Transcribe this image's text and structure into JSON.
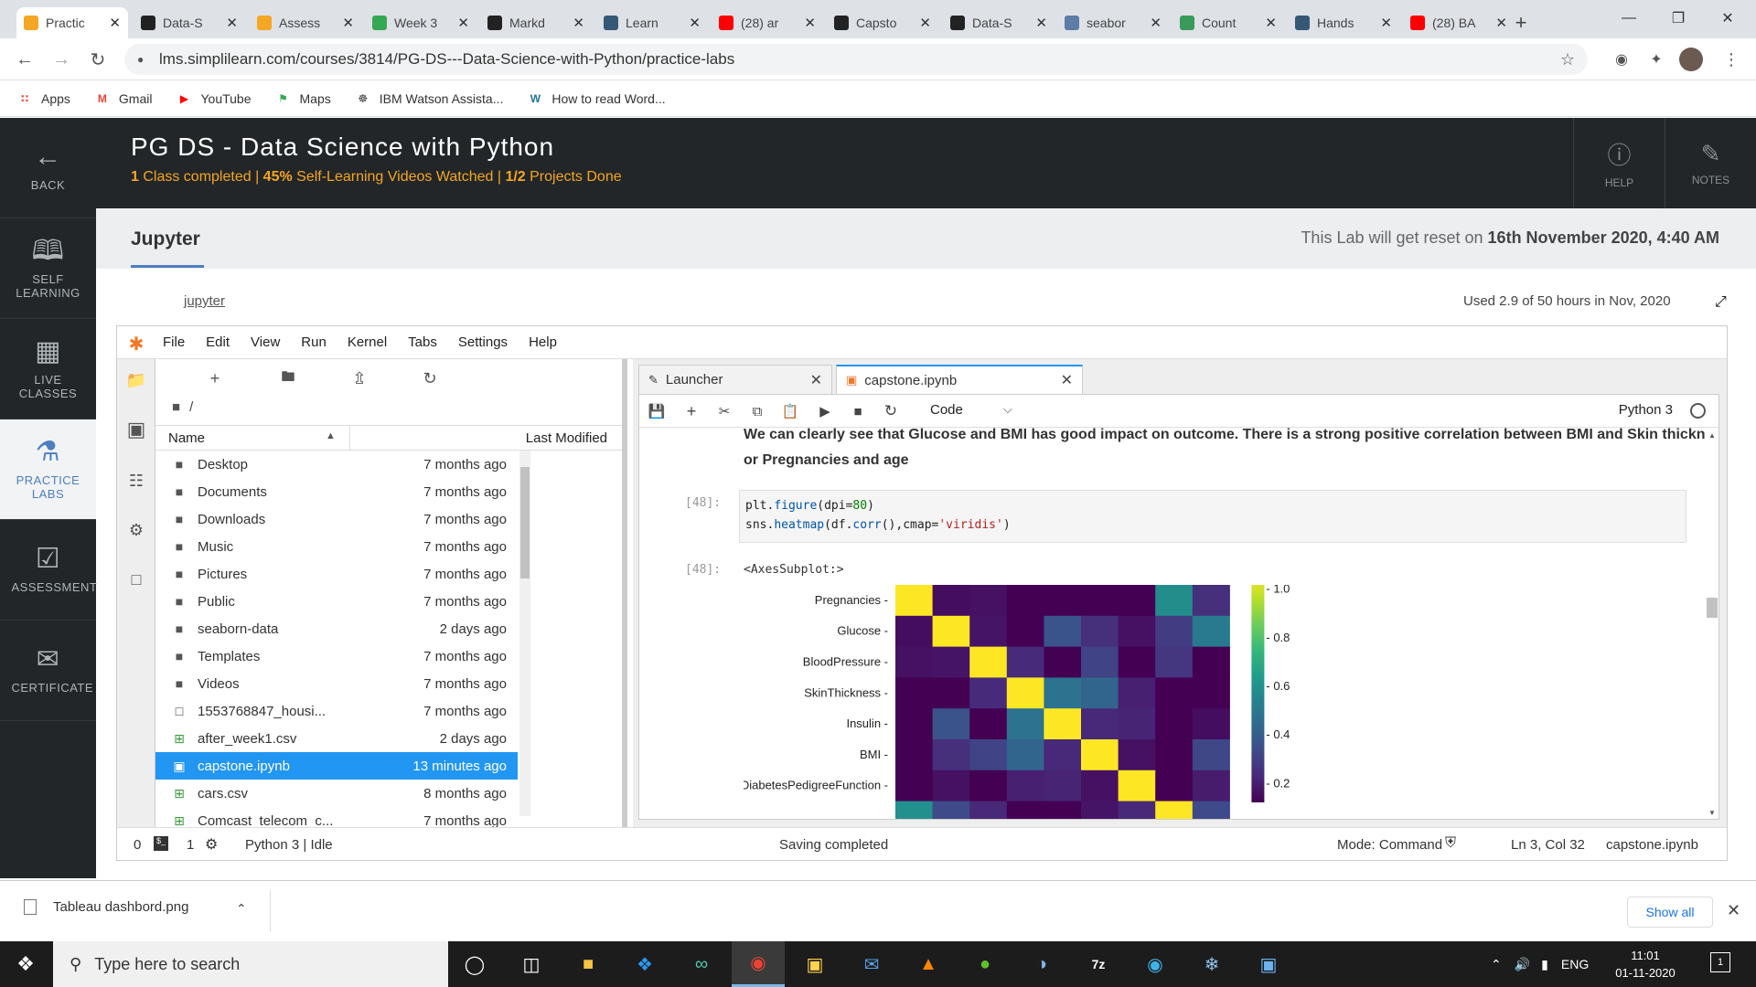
{
  "browser": {
    "tabs": [
      {
        "title": "Practic",
        "icon": "simplilearn-icon",
        "color": "#f5a623"
      },
      {
        "title": "Data-S",
        "icon": "github-icon",
        "color": "#222222"
      },
      {
        "title": "Assess",
        "icon": "simplilearn-icon",
        "color": "#f5a623"
      },
      {
        "title": "Week 3",
        "icon": "drive-icon",
        "color": "#34a853"
      },
      {
        "title": "Markd",
        "icon": "github-icon",
        "color": "#222222"
      },
      {
        "title": "Learn",
        "icon": "tds-icon",
        "color": "#355876"
      },
      {
        "title": "(28) ar",
        "icon": "youtube-icon",
        "color": "#ff0000"
      },
      {
        "title": "Capsto",
        "icon": "github-icon",
        "color": "#222222"
      },
      {
        "title": "Data-S",
        "icon": "github-icon",
        "color": "#222222"
      },
      {
        "title": "seabor",
        "icon": "seaborn-icon",
        "color": "#5b7da6"
      },
      {
        "title": "Count",
        "icon": "link-icon",
        "color": "#3a9a5b"
      },
      {
        "title": "Hands",
        "icon": "tds-icon",
        "color": "#355876"
      },
      {
        "title": "(28) BA",
        "icon": "youtube-icon",
        "color": "#ff0000"
      }
    ],
    "url": "lms.simplilearn.com/courses/3814/PG-DS---Data-Science-with-Python/practice-labs",
    "bookmarks": [
      {
        "label": "Apps",
        "icon": "apps-grid-icon",
        "color": "#e8453c"
      },
      {
        "label": "Gmail",
        "icon": "gmail-icon",
        "color": "#ea4335"
      },
      {
        "label": "YouTube",
        "icon": "youtube-icon",
        "color": "#ff0000"
      },
      {
        "label": "Maps",
        "icon": "maps-icon",
        "color": "#34a853"
      },
      {
        "label": "IBM Watson Assista...",
        "icon": "watson-icon",
        "color": "#333333"
      },
      {
        "label": "How to read Word...",
        "icon": "wordpress-icon",
        "color": "#21759b"
      }
    ]
  },
  "rail": [
    {
      "label": "BACK",
      "icon": "arrow-left-icon"
    },
    {
      "label": "SELF LEARNING",
      "icon": "book-icon"
    },
    {
      "label": "LIVE CLASSES",
      "icon": "calendar-icon"
    },
    {
      "label": "PRACTICE LABS",
      "icon": "flask-icon"
    },
    {
      "label": "ASSESSMENT",
      "icon": "clipboard-check-icon"
    },
    {
      "label": "CERTIFICATE",
      "icon": "certificate-icon"
    }
  ],
  "course": {
    "title": "PG DS - Data Science with Python",
    "progress_a": "1",
    "progress_b": " Class completed | ",
    "progress_c": "45%",
    "progress_d": " Self-Learning Videos Watched  | ",
    "progress_e": "1/2",
    "progress_f": " Projects Done",
    "help": "HELP",
    "notes": "NOTES"
  },
  "lab": {
    "title": "Jupyter",
    "reset_prefix": "This Lab will get reset on ",
    "reset_date": "16th November 2020, 4:40 AM",
    "link": "jupyter",
    "usage": "Used 2.9 of 50 hours in Nov, 2020"
  },
  "jupyter": {
    "menus": [
      "File",
      "Edit",
      "View",
      "Run",
      "Kernel",
      "Tabs",
      "Settings",
      "Help"
    ],
    "breadcrumb": "/",
    "col_name": "Name",
    "col_modified": "Last Modified",
    "files": [
      {
        "name": "Desktop",
        "modified": "7 months ago",
        "type": "folder"
      },
      {
        "name": "Documents",
        "modified": "7 months ago",
        "type": "folder"
      },
      {
        "name": "Downloads",
        "modified": "7 months ago",
        "type": "folder"
      },
      {
        "name": "Music",
        "modified": "7 months ago",
        "type": "folder"
      },
      {
        "name": "Pictures",
        "modified": "7 months ago",
        "type": "folder"
      },
      {
        "name": "Public",
        "modified": "7 months ago",
        "type": "folder"
      },
      {
        "name": "seaborn-data",
        "modified": "2 days ago",
        "type": "folder"
      },
      {
        "name": "Templates",
        "modified": "7 months ago",
        "type": "folder"
      },
      {
        "name": "Videos",
        "modified": "7 months ago",
        "type": "folder"
      },
      {
        "name": "1553768847_housi...",
        "modified": "7 months ago",
        "type": "file"
      },
      {
        "name": "after_week1.csv",
        "modified": "2 days ago",
        "type": "csv"
      },
      {
        "name": "capstone.ipynb",
        "modified": "13 minutes ago",
        "type": "notebook",
        "selected": true
      },
      {
        "name": "cars.csv",
        "modified": "8 months ago",
        "type": "csv"
      },
      {
        "name": "Comcast_telecom_c...",
        "modified": "7 months ago",
        "type": "csv"
      }
    ],
    "tabs": [
      {
        "label": "Launcher"
      },
      {
        "label": "capstone.ipynb"
      }
    ],
    "cell_type": "Code",
    "kernel": "Python 3",
    "markdown": "We can clearly see that Glucose and BMI has good impact on outcome. There is a strong positive correlation between BMI and Skin thickness or Pregnancies and age",
    "prompt_in": "[48]:",
    "prompt_out": "[48]:",
    "code_line1_a": "plt.",
    "code_line1_b": "figure",
    "code_line1_c": "(dpi=",
    "code_line1_d": "80",
    "code_line1_e": ")",
    "code_line2_a": "sns.",
    "code_line2_b": "heatmap",
    "code_line2_c": "(df.",
    "code_line2_d": "corr",
    "code_line2_e": "(),cmap=",
    "code_line2_f": "'viridis'",
    "code_line2_g": ")",
    "output_repr": "<AxesSubplot:>",
    "status": {
      "left_a": "0",
      "left_b": "1",
      "kernel_state": "Python 3 | Idle",
      "message": "Saving completed",
      "mode": "Mode: Command",
      "cursor": "Ln 3, Col 32",
      "file": "capstone.ipynb"
    }
  },
  "chart_data": {
    "type": "heatmap",
    "title": "",
    "xlabel": "",
    "ylabel": "",
    "rows": [
      "Pregnancies",
      "Glucose",
      "BloodPressure",
      "SkinThickness",
      "Insulin",
      "BMI",
      "DiabetesPedigreeFunction"
    ],
    "ncols": 9,
    "colormap": "viridis",
    "colorbar_ticks": [
      "1.0",
      "0.8",
      "0.6",
      "0.4",
      "0.2"
    ],
    "vmin": 0.1,
    "vmax": 1.0,
    "values": [
      [
        1.0,
        0.13,
        0.14,
        -0.08,
        -0.07,
        0.02,
        -0.03,
        0.54,
        0.22
      ],
      [
        0.13,
        1.0,
        0.15,
        0.06,
        0.33,
        0.22,
        0.14,
        0.26,
        0.47
      ],
      [
        0.14,
        0.15,
        1.0,
        0.21,
        0.09,
        0.28,
        0.04,
        0.24,
        0.07
      ],
      [
        -0.08,
        0.06,
        0.21,
        1.0,
        0.44,
        0.39,
        0.18,
        -0.11,
        0.07
      ],
      [
        -0.07,
        0.33,
        0.09,
        0.44,
        1.0,
        0.2,
        0.19,
        -0.04,
        0.13
      ],
      [
        0.02,
        0.22,
        0.28,
        0.39,
        0.2,
        1.0,
        0.14,
        0.04,
        0.29
      ],
      [
        -0.03,
        0.14,
        0.04,
        0.18,
        0.19,
        0.14,
        1.0,
        0.03,
        0.17
      ]
    ]
  },
  "downloads": {
    "file": "Tableau dashbord.png",
    "show_all": "Show all"
  },
  "taskbar": {
    "search_placeholder": "Type here to search",
    "lang": "ENG",
    "time": "11:01",
    "date": "01-11-2020",
    "notifications": "1"
  }
}
